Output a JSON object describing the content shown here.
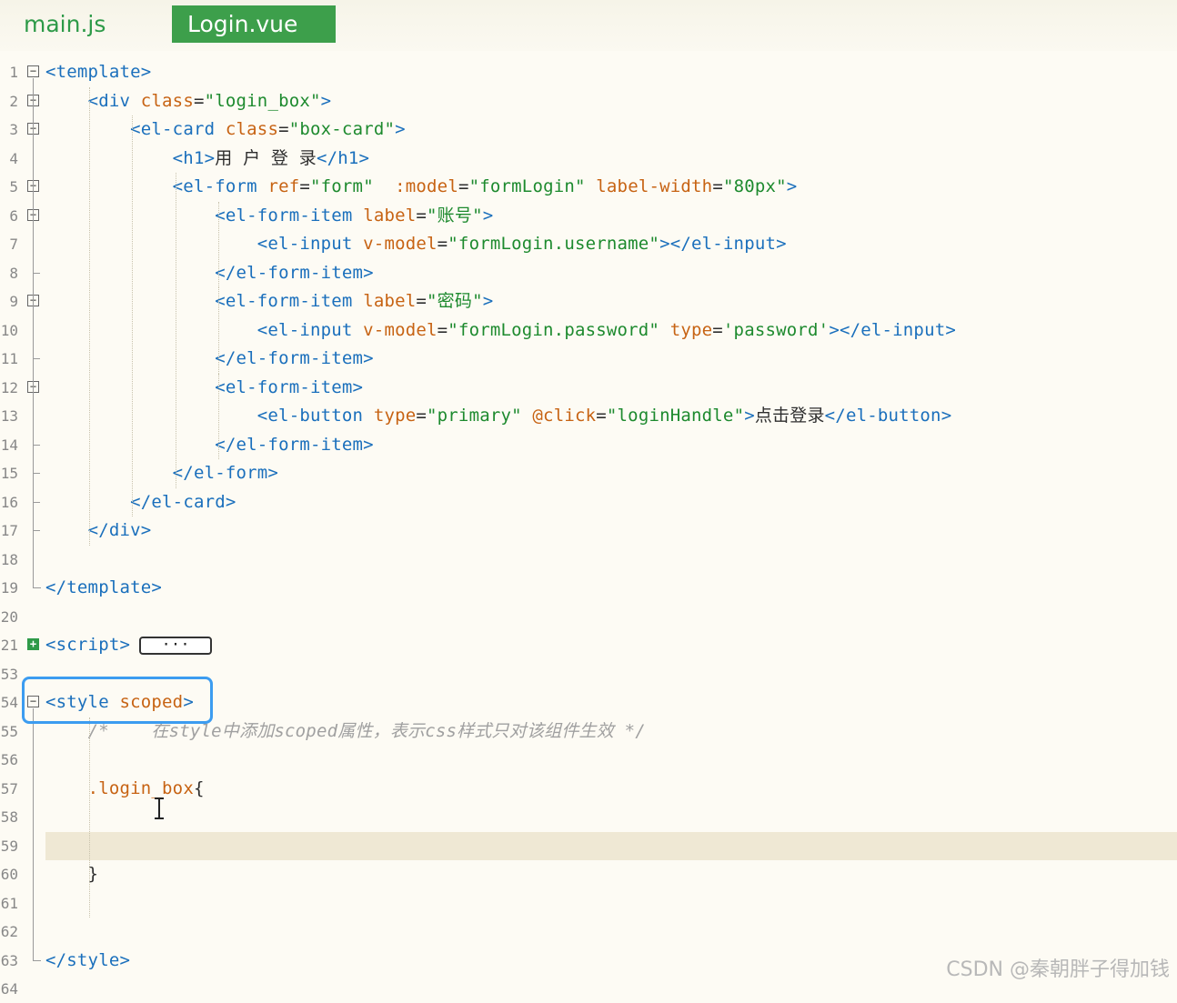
{
  "tabs": [
    {
      "label": "main.js",
      "active": false
    },
    {
      "label": "Login.vue",
      "active": true
    }
  ],
  "colors": {
    "tag": "#1a6fbc",
    "attr": "#c76313",
    "value": "#1d8a2e",
    "comment": "#a0a0a0",
    "active_tab": "#3d9f4b",
    "selection_box": "#3c9cf0"
  },
  "editor": {
    "lines": [
      {
        "num": "1",
        "fold": "minus",
        "parts": [
          [
            "t",
            "<template>"
          ]
        ]
      },
      {
        "num": "2",
        "fold": "minus",
        "parts": [
          [
            "p",
            "    "
          ],
          [
            "t",
            "<div "
          ],
          [
            "a",
            "class"
          ],
          [
            "p",
            "="
          ],
          [
            "v",
            "\"login_box\""
          ],
          [
            "t",
            ">"
          ]
        ]
      },
      {
        "num": "3",
        "fold": "minus",
        "parts": [
          [
            "p",
            "        "
          ],
          [
            "t",
            "<el-card "
          ],
          [
            "a",
            "class"
          ],
          [
            "p",
            "="
          ],
          [
            "v",
            "\"box-card\""
          ],
          [
            "t",
            ">"
          ]
        ]
      },
      {
        "num": "4",
        "fold": "",
        "parts": [
          [
            "p",
            "            "
          ],
          [
            "t",
            "<h1>"
          ],
          [
            "p",
            "用 户 登 录"
          ],
          [
            "t",
            "</h1>"
          ]
        ]
      },
      {
        "num": "5",
        "fold": "minus",
        "parts": [
          [
            "p",
            "            "
          ],
          [
            "t",
            "<el-form "
          ],
          [
            "a",
            "ref"
          ],
          [
            "p",
            "="
          ],
          [
            "v",
            "\"form\""
          ],
          [
            "p",
            "  "
          ],
          [
            "a",
            ":model"
          ],
          [
            "p",
            "="
          ],
          [
            "v",
            "\"formLogin\""
          ],
          [
            "p",
            " "
          ],
          [
            "a",
            "label-width"
          ],
          [
            "p",
            "="
          ],
          [
            "v",
            "\"80px\""
          ],
          [
            "t",
            ">"
          ]
        ]
      },
      {
        "num": "6",
        "fold": "minus",
        "parts": [
          [
            "p",
            "                "
          ],
          [
            "t",
            "<el-form-item "
          ],
          [
            "a",
            "label"
          ],
          [
            "p",
            "="
          ],
          [
            "v",
            "\"账号\""
          ],
          [
            "t",
            ">"
          ]
        ]
      },
      {
        "num": "7",
        "fold": "",
        "parts": [
          [
            "p",
            "                    "
          ],
          [
            "t",
            "<el-input "
          ],
          [
            "a",
            "v-model"
          ],
          [
            "p",
            "="
          ],
          [
            "v",
            "\"formLogin.username\""
          ],
          [
            "t",
            "></el-input>"
          ]
        ]
      },
      {
        "num": "8",
        "fold": "",
        "parts": [
          [
            "p",
            "                "
          ],
          [
            "t",
            "</el-form-item>"
          ]
        ]
      },
      {
        "num": "9",
        "fold": "minus",
        "parts": [
          [
            "p",
            "                "
          ],
          [
            "t",
            "<el-form-item "
          ],
          [
            "a",
            "label"
          ],
          [
            "p",
            "="
          ],
          [
            "v",
            "\"密码\""
          ],
          [
            "t",
            ">"
          ]
        ]
      },
      {
        "num": "10",
        "fold": "",
        "parts": [
          [
            "p",
            "                    "
          ],
          [
            "t",
            "<el-input "
          ],
          [
            "a",
            "v-model"
          ],
          [
            "p",
            "="
          ],
          [
            "v",
            "\"formLogin.password\""
          ],
          [
            "p",
            " "
          ],
          [
            "a",
            "type"
          ],
          [
            "p",
            "="
          ],
          [
            "v",
            "'password'"
          ],
          [
            "t",
            "></el-input>"
          ]
        ]
      },
      {
        "num": "11",
        "fold": "",
        "parts": [
          [
            "p",
            "                "
          ],
          [
            "t",
            "</el-form-item>"
          ]
        ]
      },
      {
        "num": "12",
        "fold": "minus",
        "parts": [
          [
            "p",
            "                "
          ],
          [
            "t",
            "<el-form-item>"
          ]
        ]
      },
      {
        "num": "13",
        "fold": "",
        "parts": [
          [
            "p",
            "                    "
          ],
          [
            "t",
            "<el-button "
          ],
          [
            "a",
            "type"
          ],
          [
            "p",
            "="
          ],
          [
            "v",
            "\"primary\""
          ],
          [
            "p",
            " "
          ],
          [
            "a",
            "@click"
          ],
          [
            "p",
            "="
          ],
          [
            "v",
            "\"loginHandle\""
          ],
          [
            "t",
            ">"
          ],
          [
            "p",
            "点击登录"
          ],
          [
            "t",
            "</el-button>"
          ]
        ]
      },
      {
        "num": "14",
        "fold": "",
        "parts": [
          [
            "p",
            "                "
          ],
          [
            "t",
            "</el-form-item>"
          ]
        ]
      },
      {
        "num": "15",
        "fold": "",
        "parts": [
          [
            "p",
            "            "
          ],
          [
            "t",
            "</el-form>"
          ]
        ]
      },
      {
        "num": "16",
        "fold": "",
        "parts": [
          [
            "p",
            "        "
          ],
          [
            "t",
            "</el-card>"
          ]
        ]
      },
      {
        "num": "17",
        "fold": "",
        "parts": [
          [
            "p",
            "    "
          ],
          [
            "t",
            "</div>"
          ]
        ]
      },
      {
        "num": "18",
        "fold": "",
        "parts": []
      },
      {
        "num": "19",
        "fold": "",
        "parts": [
          [
            "t",
            "</template>"
          ]
        ]
      },
      {
        "num": "20",
        "fold": "",
        "parts": []
      },
      {
        "num": "21",
        "fold": "plus",
        "parts": [
          [
            "t",
            "<script>"
          ]
        ],
        "collapsed": "···"
      },
      {
        "num": "53",
        "fold": "",
        "parts": []
      },
      {
        "num": "54",
        "fold": "minus",
        "parts": [
          [
            "t",
            "<style "
          ],
          [
            "a",
            "scoped"
          ],
          [
            "t",
            ">"
          ]
        ]
      },
      {
        "num": "55",
        "fold": "",
        "parts": [
          [
            "p",
            "    "
          ],
          [
            "c",
            "/*    在style中添加scoped属性，表示css样式只对该组件生效 */"
          ]
        ]
      },
      {
        "num": "56",
        "fold": "",
        "parts": []
      },
      {
        "num": "57",
        "fold": "",
        "parts": [
          [
            "p",
            "    "
          ],
          [
            "a",
            ".login_box"
          ],
          [
            "p",
            "{"
          ]
        ]
      },
      {
        "num": "58",
        "fold": "",
        "parts": []
      },
      {
        "num": "59",
        "fold": "",
        "parts": [],
        "highlight": true
      },
      {
        "num": "60",
        "fold": "",
        "parts": [
          [
            "p",
            "    }"
          ]
        ]
      },
      {
        "num": "61",
        "fold": "",
        "parts": []
      },
      {
        "num": "62",
        "fold": "",
        "parts": []
      },
      {
        "num": "63",
        "fold": "",
        "parts": [
          [
            "t",
            "</style>"
          ]
        ]
      },
      {
        "num": "64",
        "fold": "",
        "parts": []
      }
    ]
  },
  "watermark": "CSDN @秦朝胖子得加钱"
}
